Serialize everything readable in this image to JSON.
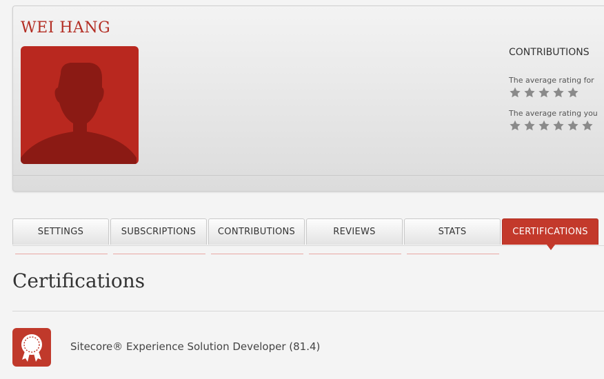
{
  "profile": {
    "name": "WEI HANG",
    "contributions_title": "CONTRIBUTIONS",
    "rating_for_text": "The average rating for",
    "rating_you_text": "The average rating you",
    "rating_for_stars": 0,
    "rating_you_stars": 0
  },
  "tabs": [
    {
      "label": "SETTINGS",
      "active": false
    },
    {
      "label": "SUBSCRIPTIONS",
      "active": false
    },
    {
      "label": "CONTRIBUTIONS",
      "active": false
    },
    {
      "label": "REVIEWS",
      "active": false
    },
    {
      "label": "STATS",
      "active": false
    },
    {
      "label": "CERTIFICATIONS",
      "active": true
    }
  ],
  "section": {
    "title": "Certifications"
  },
  "certifications": [
    {
      "name": "Sitecore® Experience Solution Developer (81.4)",
      "icon": "certificate-ribbon-icon"
    }
  ],
  "colors": {
    "accent": "#c3392b",
    "name_red": "#b32d23",
    "star_gray": "#8a8a8a"
  }
}
